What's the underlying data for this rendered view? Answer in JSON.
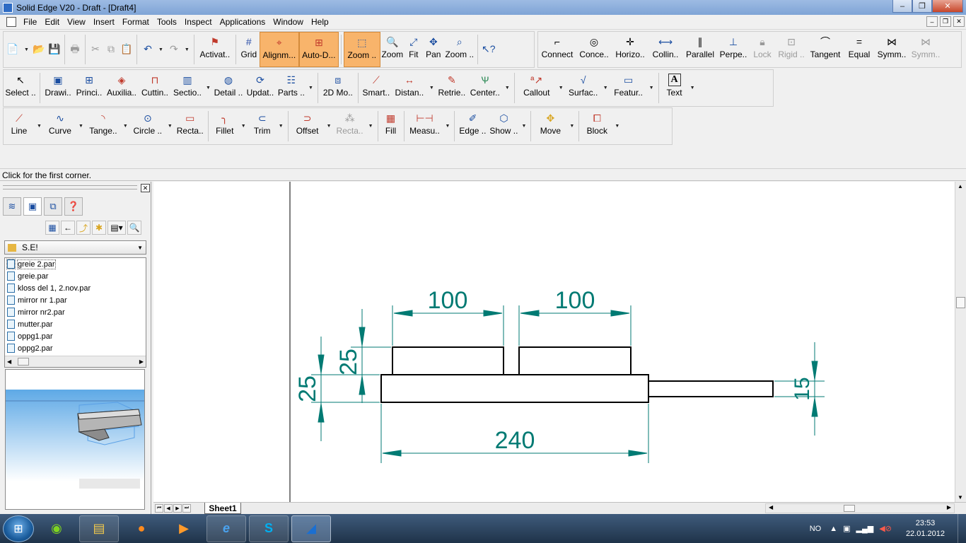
{
  "window": {
    "title": "Solid Edge V20 - Draft - [Draft4]",
    "controls": [
      "–",
      "❐",
      "✕"
    ]
  },
  "menubar": {
    "items": [
      "File",
      "Edit",
      "View",
      "Insert",
      "Format",
      "Tools",
      "Inspect",
      "Applications",
      "Window",
      "Help"
    ],
    "mdi_controls": [
      "–",
      "❐",
      "✕"
    ]
  },
  "toolbar1": {
    "items": [
      {
        "label": "Activat..",
        "icon": "activate-icon"
      },
      {
        "label": "Grid",
        "icon": "grid-icon"
      },
      {
        "label": "Alignm...",
        "icon": "alignment-icon",
        "active": true
      },
      {
        "label": "Auto-D...",
        "icon": "auto-dimension-icon",
        "active": true
      },
      {
        "label": "Zoom ..",
        "icon": "zoom-area-icon",
        "active": true
      },
      {
        "label": "Zoom",
        "icon": "zoom-icon"
      },
      {
        "label": "Fit",
        "icon": "fit-icon"
      },
      {
        "label": "Pan",
        "icon": "pan-icon"
      },
      {
        "label": "Zoom ..",
        "icon": "zoom-in-out-icon"
      }
    ]
  },
  "toolbar_relations": {
    "items": [
      {
        "label": "Connect",
        "icon": "connect-icon"
      },
      {
        "label": "Conce..",
        "icon": "concentric-icon"
      },
      {
        "label": "Horizo..",
        "icon": "horizontal-icon"
      },
      {
        "label": "Collin..",
        "icon": "collinear-icon"
      },
      {
        "label": "Parallel",
        "icon": "parallel-icon"
      },
      {
        "label": "Perpe..",
        "icon": "perpendicular-icon"
      },
      {
        "label": "Lock",
        "icon": "lock-icon",
        "disabled": true
      },
      {
        "label": "Rigid ..",
        "icon": "rigid-set-icon",
        "disabled": true
      },
      {
        "label": "Tangent",
        "icon": "tangent-icon"
      },
      {
        "label": "Equal",
        "icon": "equal-icon"
      },
      {
        "label": "Symm..",
        "icon": "symmetric-icon"
      },
      {
        "label": "Symm..",
        "icon": "symmetric-axis-icon",
        "disabled": true
      }
    ]
  },
  "toolbar2": {
    "items": [
      {
        "label": "Select ..",
        "icon": "select-icon"
      },
      {
        "label": "Drawi..",
        "icon": "drawing-view-icon"
      },
      {
        "label": "Princi..",
        "icon": "principal-view-icon"
      },
      {
        "label": "Auxilia..",
        "icon": "auxiliary-view-icon"
      },
      {
        "label": "Cuttin..",
        "icon": "cutting-plane-icon"
      },
      {
        "label": "Sectio..",
        "icon": "section-view-icon"
      },
      {
        "label": "Detail ..",
        "icon": "detail-view-icon"
      },
      {
        "label": "Updat..",
        "icon": "update-views-icon"
      },
      {
        "label": "Parts ..",
        "icon": "parts-list-icon"
      },
      {
        "label": "2D Mo..",
        "icon": "2d-model-view-icon"
      },
      {
        "label": "Smart..",
        "icon": "smart-dimension-icon"
      },
      {
        "label": "Distan..",
        "icon": "distance-between-icon"
      },
      {
        "label": "Retrie..",
        "icon": "retrieve-dimensions-icon"
      },
      {
        "label": "Center..",
        "icon": "center-mark-icon"
      },
      {
        "label": "Callout",
        "icon": "callout-icon"
      },
      {
        "label": "Surfac..",
        "icon": "surface-texture-icon"
      },
      {
        "label": "Featur..",
        "icon": "feature-control-frame-icon"
      },
      {
        "label": "Text",
        "icon": "text-icon"
      }
    ]
  },
  "toolbar3": {
    "items": [
      {
        "label": "Line",
        "icon": "line-icon"
      },
      {
        "label": "Curve",
        "icon": "curve-icon"
      },
      {
        "label": "Tange..",
        "icon": "tangent-arc-icon"
      },
      {
        "label": "Circle ..",
        "icon": "circle-icon"
      },
      {
        "label": "Recta..",
        "icon": "rectangle-icon"
      },
      {
        "label": "Fillet",
        "icon": "fillet-icon"
      },
      {
        "label": "Trim",
        "icon": "trim-icon"
      },
      {
        "label": "Offset",
        "icon": "offset-icon"
      },
      {
        "label": "Recta..",
        "icon": "rectangular-pattern-icon",
        "disabled": true
      },
      {
        "label": "Fill",
        "icon": "fill-icon"
      },
      {
        "label": "Measu..",
        "icon": "measure-icon"
      },
      {
        "label": "Edge ..",
        "icon": "edge-painter-icon"
      },
      {
        "label": "Show ..",
        "icon": "show-hide-icon"
      },
      {
        "label": "Move",
        "icon": "move-icon"
      },
      {
        "label": "Block",
        "icon": "block-icon"
      }
    ]
  },
  "prompt": "Click for the first corner.",
  "library": {
    "folder": "S.E!",
    "files": [
      "greie 2.par",
      "greie.par",
      "kloss del 1, 2.nov.par",
      "mirror nr 1.par",
      "mirror nr2.par",
      "mutter.par",
      "oppg1.par",
      "oppg2.par"
    ]
  },
  "drawing": {
    "dimensions": {
      "top_left": "100",
      "top_right": "100",
      "left_outer": "25",
      "left_inner": "25",
      "bottom": "240",
      "right": "15"
    },
    "line_color": "#000000",
    "dimension_color": "#007a73"
  },
  "sheet_tab": "Sheet1",
  "taskbar": {
    "language": "NO",
    "time": "23:53",
    "date": "22.01.2012"
  }
}
